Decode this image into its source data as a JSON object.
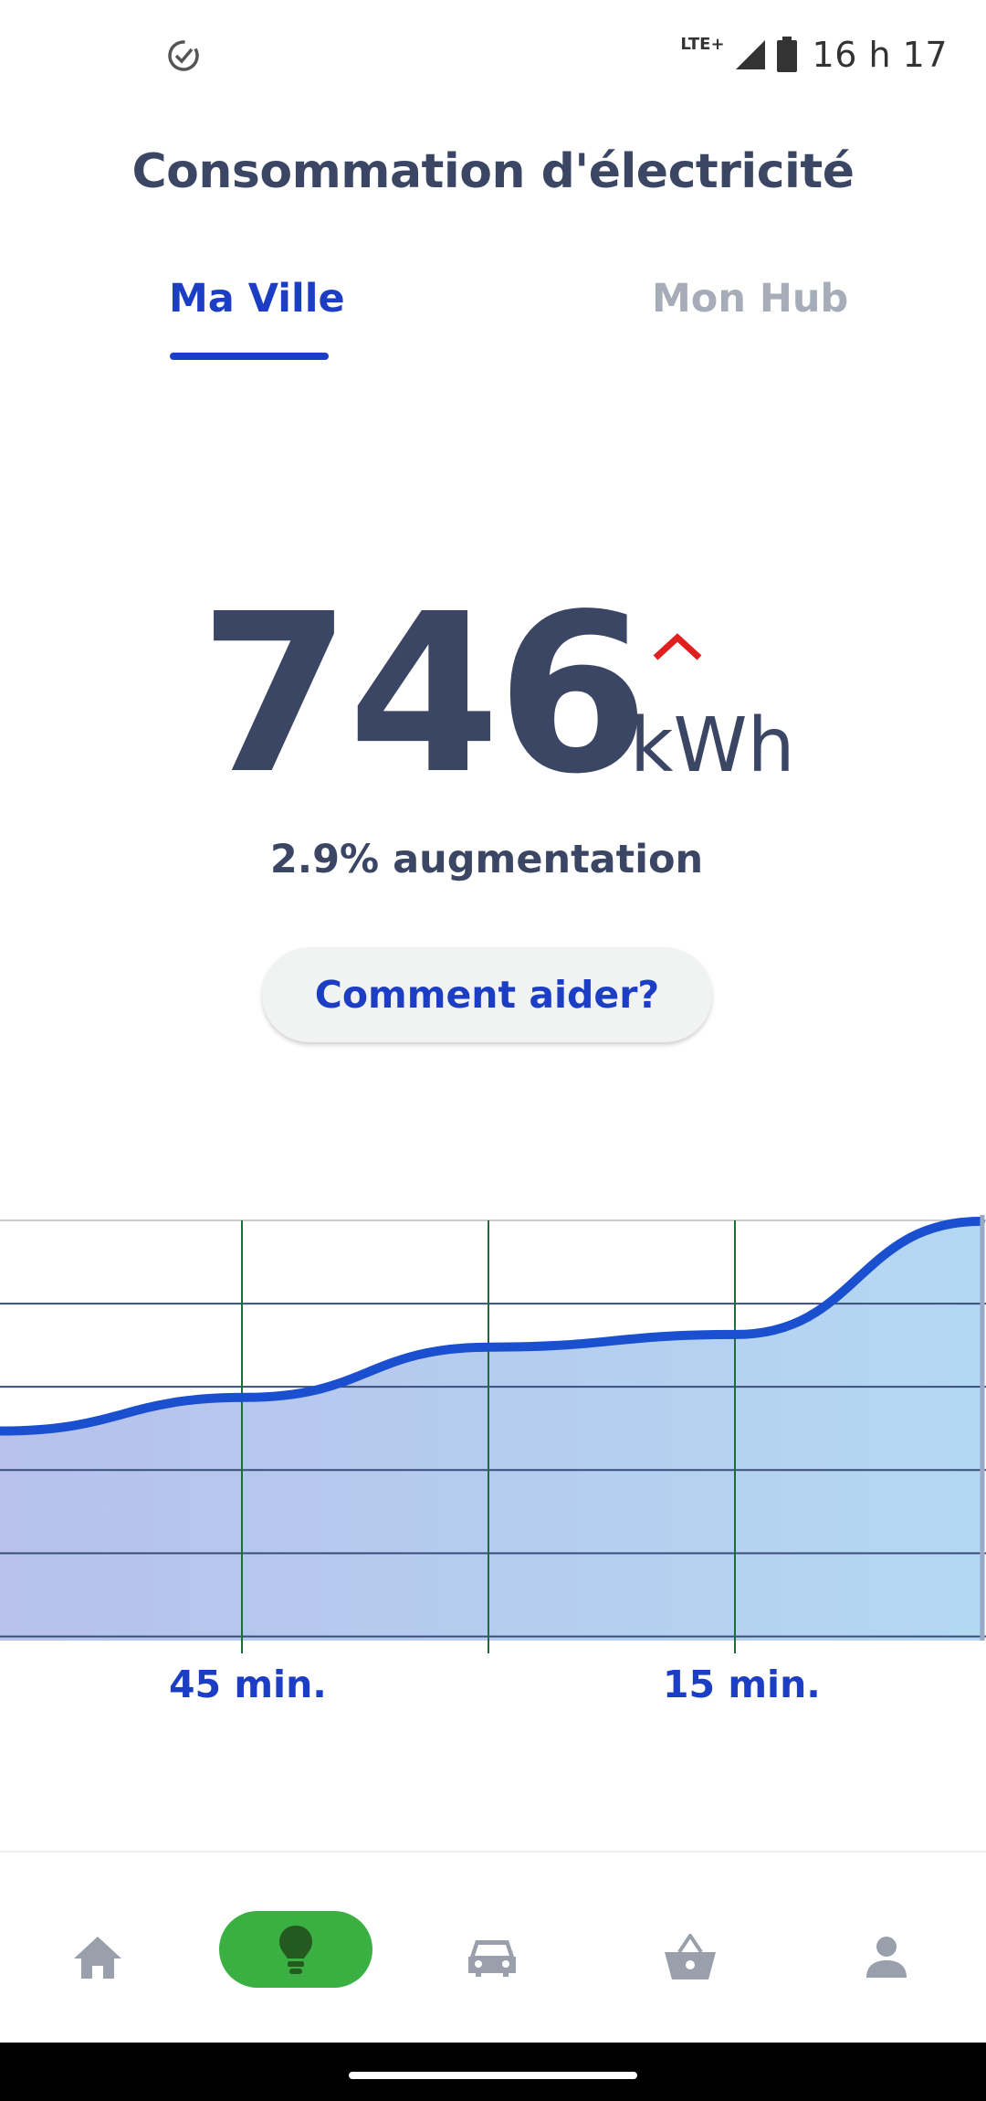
{
  "status_bar": {
    "network": "LTE+",
    "time": "16 h 17"
  },
  "page": {
    "title": "Consommation d'électricité"
  },
  "tabs": [
    {
      "label": "Ma Ville",
      "active": true
    },
    {
      "label": "Mon Hub",
      "active": false
    }
  ],
  "consumption": {
    "value": "746",
    "unit": "kWh",
    "trend": "up",
    "change_text": "2.9% augmentation"
  },
  "help_button": {
    "label": "Comment aider?"
  },
  "chart_data": {
    "type": "area",
    "x_labels": [
      "45 min.",
      "15 min."
    ],
    "values": [
      0.5,
      0.58,
      0.7,
      0.73,
      1.0
    ],
    "colors": {
      "line": "#1a4fcf",
      "fill_start": "#b7c1ec",
      "fill_end": "#b3d8f2",
      "grid_h": "#3a4e7a",
      "grid_v": "#1f6b3a"
    }
  },
  "bottom_nav": {
    "items": [
      {
        "icon": "home-icon",
        "active": false
      },
      {
        "icon": "lightbulb-icon",
        "active": true
      },
      {
        "icon": "car-icon",
        "active": false
      },
      {
        "icon": "basket-icon",
        "active": false
      },
      {
        "icon": "person-icon",
        "active": false
      }
    ],
    "active_color": "#3ab043",
    "inactive_color": "#9aa0ab"
  }
}
